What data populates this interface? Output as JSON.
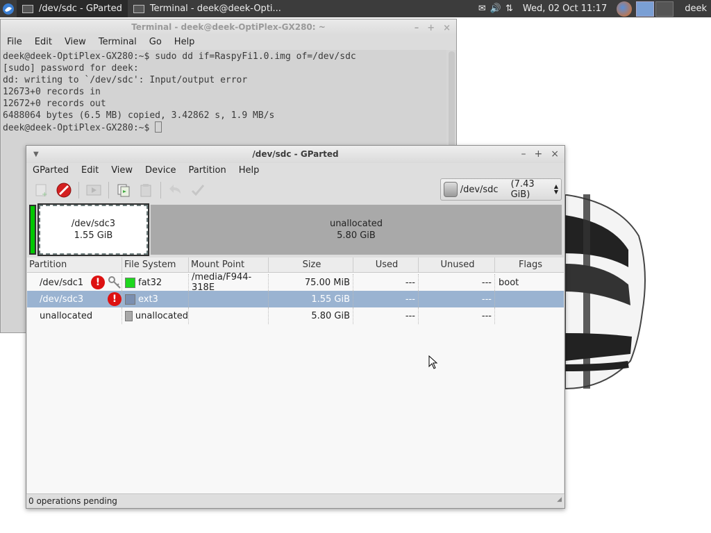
{
  "panel": {
    "tasks": [
      {
        "label": "/dev/sdc - GParted",
        "active": true
      },
      {
        "label": "Terminal - deek@deek-Opti...",
        "active": false
      }
    ],
    "clock": "Wed, 02 Oct  11:17",
    "user": "deek"
  },
  "terminal": {
    "title": "Terminal - deek@deek-OptiPlex-GX280: ~",
    "menu": [
      "File",
      "Edit",
      "View",
      "Terminal",
      "Go",
      "Help"
    ],
    "lines": [
      "deek@deek-OptiPlex-GX280:~$ sudo dd if=RaspyFi1.0.img of=/dev/sdc",
      "[sudo] password for deek:",
      "dd: writing to `/dev/sdc': Input/output error",
      "12673+0 records in",
      "12672+0 records out",
      "6488064 bytes (6.5 MB) copied, 3.42862 s, 1.9 MB/s"
    ],
    "prompt": "deek@deek-OptiPlex-GX280:~$ "
  },
  "gparted": {
    "title": "/dev/sdc - GParted",
    "menu": [
      "GParted",
      "Edit",
      "View",
      "Device",
      "Partition",
      "Help"
    ],
    "device": {
      "name": "/dev/sdc",
      "size": "(7.43 GiB)"
    },
    "map": {
      "sdc3": {
        "name": "/dev/sdc3",
        "size": "1.55 GiB"
      },
      "unallocated": {
        "name": "unallocated",
        "size": "5.80 GiB"
      }
    },
    "columns": [
      "Partition",
      "File System",
      "Mount Point",
      "Size",
      "Used",
      "Unused",
      "Flags"
    ],
    "rows": [
      {
        "partition": "/dev/sdc1",
        "fs": "fat32",
        "fs_color": "#1ed71e",
        "mount": "/media/F944-318E",
        "size": "75.00 MiB",
        "used": "---",
        "unused": "---",
        "flags": "boot",
        "warning": true,
        "locked": true,
        "selected": false
      },
      {
        "partition": "/dev/sdc3",
        "fs": "ext3",
        "fs_color": "#7b8fb0",
        "mount": "",
        "size": "1.55 GiB",
        "used": "---",
        "unused": "---",
        "flags": "",
        "warning": true,
        "locked": false,
        "selected": true
      },
      {
        "partition": "unallocated",
        "fs": "unallocated",
        "fs_color": "#a9a9a9",
        "mount": "",
        "size": "5.80 GiB",
        "used": "---",
        "unused": "---",
        "flags": "",
        "warning": false,
        "locked": false,
        "selected": false
      }
    ],
    "status": "0 operations pending"
  }
}
